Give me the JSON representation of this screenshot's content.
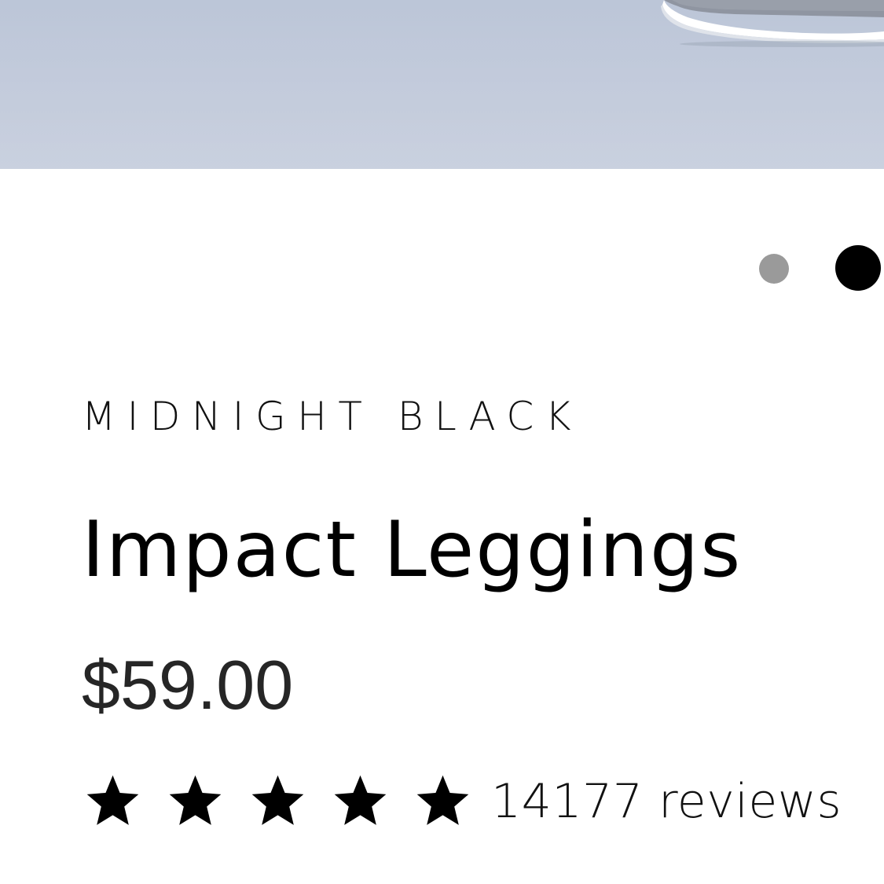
{
  "product": {
    "variant": "MIDNIGHT BLACK",
    "title": "Impact Leggings",
    "price": "$59.00",
    "rating": {
      "stars_filled": 5,
      "stars_total": 5,
      "review_count_text": "14177 reviews"
    }
  },
  "carousel": {
    "total_slides": 2,
    "active_index": 1,
    "active_color": "#000000",
    "inactive_color": "#9a9a9a"
  },
  "hero_image": {
    "depicts": "sneaker on grey floor",
    "background_color": "#c2cadb"
  },
  "icons": {
    "rating_star": "star-icon"
  }
}
